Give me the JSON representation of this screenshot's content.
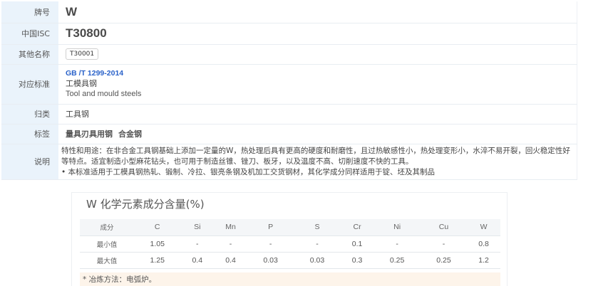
{
  "info": {
    "grade": {
      "label": "牌号",
      "value": "W"
    },
    "isc": {
      "label": "中国ISC",
      "value": "T30800"
    },
    "aliases": {
      "label": "其他名称",
      "chip": "T30001"
    },
    "standard": {
      "label": "对应标准",
      "link": "GB /T 1299-2014",
      "line1": "工模具钢",
      "line2": "Tool and mould steels"
    },
    "category": {
      "label": "归类",
      "value": "工具钢"
    },
    "tags": {
      "label": "标签",
      "items": [
        "量具刃具用钢",
        "合金钢"
      ]
    },
    "description": {
      "label": "说明",
      "para1": "特性和用途：在非合金工具钢基础上添加一定量的W，热处理后具有更高的硬度和耐磨性，且过热敏感性小，热处理变形小，水淬不易开裂，回火稳定性好等特点。适宜制造小型麻花钻头，也可用于制造丝锥、锉刀、板牙，以及温度不高、切削速度不快的工具。",
      "para2": "• 本标准适用于工模具钢热轧、锻制、冷拉、银亮条钢及机加工交货钢材，其化学成分同样适用于锭、坯及其制品"
    }
  },
  "composition": {
    "title": "W 化学元素成分含量(%)",
    "header_label": "成分",
    "elements": [
      "C",
      "Si",
      "Mn",
      "P",
      "S",
      "Cr",
      "Ni",
      "Cu",
      "W"
    ],
    "rows": [
      {
        "label": "最小值",
        "values": [
          "1.05",
          "-",
          "-",
          "-",
          "-",
          "0.1",
          "-",
          "-",
          "0.8"
        ]
      },
      {
        "label": "最大值",
        "values": [
          "1.25",
          "0.4",
          "0.4",
          "0.03",
          "0.03",
          "0.3",
          "0.25",
          "0.25",
          "1.2"
        ]
      }
    ],
    "note": "* 冶炼方法：电弧炉。"
  }
}
